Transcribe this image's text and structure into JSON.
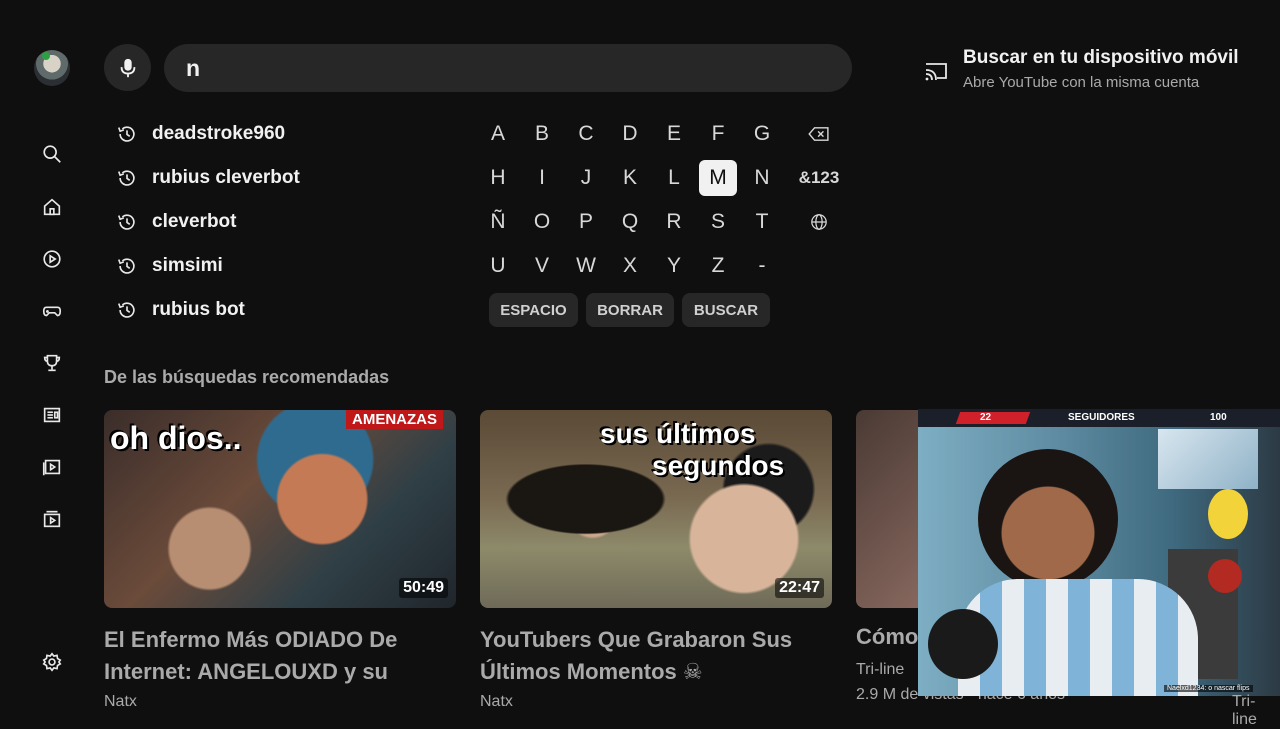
{
  "search": {
    "query": "n"
  },
  "device": {
    "title": "Buscar en tu dispositivo móvil",
    "subtitle": "Abre YouTube con la misma cuenta"
  },
  "suggestions": [
    "deadstroke960",
    "rubius cleverbot",
    "cleverbot",
    "simsimi",
    "rubius bot"
  ],
  "keyboard": {
    "rows": [
      [
        "A",
        "B",
        "C",
        "D",
        "E",
        "F",
        "G"
      ],
      [
        "H",
        "I",
        "J",
        "K",
        "L",
        "M",
        "N"
      ],
      [
        "Ñ",
        "O",
        "P",
        "Q",
        "R",
        "S",
        "T"
      ],
      [
        "U",
        "V",
        "W",
        "X",
        "Y",
        "Z",
        "-"
      ]
    ],
    "selected_key": "M",
    "symbols_key": "&123",
    "space_label": "ESPACIO",
    "clear_label": "BORRAR",
    "search_label": "BUSCAR"
  },
  "shelf": {
    "title": "De las búsquedas recomendadas",
    "videos": [
      {
        "title": "El Enfermo Más ODIADO De Internet: ANGELOUXD y su",
        "channel": "Natx",
        "duration": "50:49",
        "thumb_text_1": "oh dios..",
        "thumb_text_2": "AMENAZAS"
      },
      {
        "title": "YouTubers Que Grabaron Sus Últimos Momentos ☠",
        "channel": "Natx",
        "duration": "22:47",
        "thumb_text_1": "sus últimos",
        "thumb_text_2": "segundos"
      },
      {
        "title": "Cómo",
        "channel": "Tri-line",
        "meta": "2.9 M de vistas · hace 6 años"
      }
    ]
  },
  "overlay": {
    "count_left": "22",
    "label": "SEGUIDORES",
    "count_right": "100",
    "footer": "Naelxd1234: o nascar flips",
    "edge_channel": "Tri-line"
  },
  "colors": {
    "background": "#0f0f0f",
    "surface": "#272727",
    "text_primary": "#f1f1f1",
    "text_secondary": "#aaaaaa",
    "accent_red": "#d0202a"
  }
}
